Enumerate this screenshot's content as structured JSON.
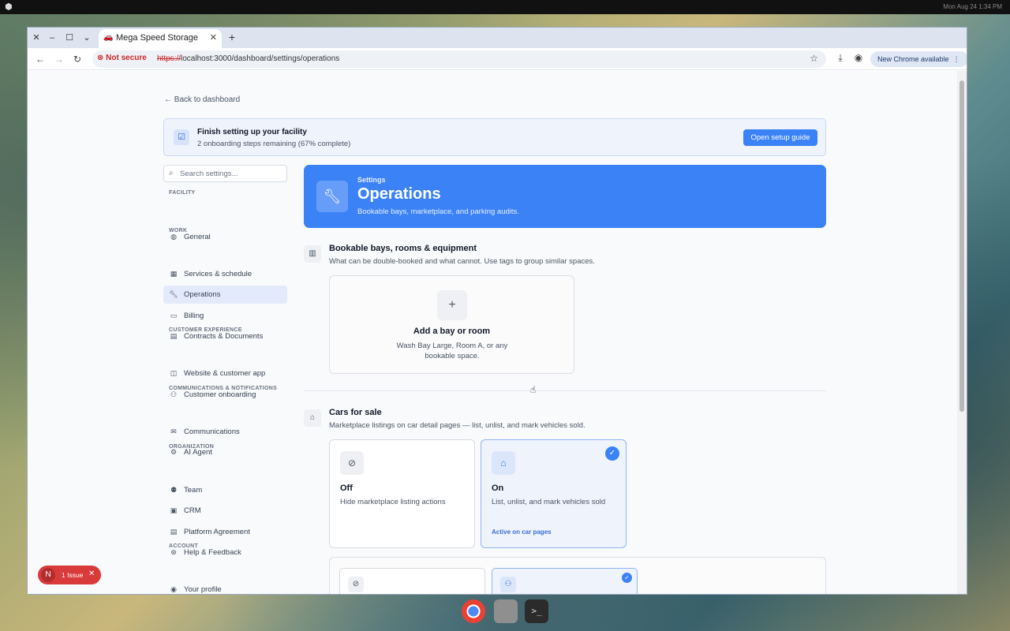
{
  "os": {
    "clock": "Mon Aug 24  1:34 PM"
  },
  "browser": {
    "tab_title": "Mega Speed Storage",
    "not_secure": "Not secure",
    "url_scheme": "https://",
    "url_rest": "localhost:3000/dashboard/settings/operations",
    "new_chrome": "New Chrome available"
  },
  "page": {
    "back_link": "Back to dashboard",
    "banner": {
      "title": "Finish setting up your facility",
      "subtitle": "2 onboarding steps remaining (67% complete)",
      "button": "Open setup guide"
    },
    "search_placeholder": "Search settings...",
    "sidebar": {
      "facility": "FACILITY",
      "general": "General",
      "work": "WORK",
      "services": "Services & schedule",
      "operations": "Operations",
      "billing": "Billing",
      "contracts": "Contracts & Documents",
      "customer_experience": "CUSTOMER EXPERIENCE",
      "website": "Website & customer app",
      "onboarding": "Customer onboarding",
      "comms_section": "COMMUNICATIONS & NOTIFICATIONS",
      "communications": "Communications",
      "ai_agent": "AI Agent",
      "organization": "ORGANIZATION",
      "team": "Team",
      "crm": "CRM",
      "platform": "Platform Agreement",
      "help": "Help & Feedback",
      "account": "ACCOUNT",
      "profile": "Your profile"
    },
    "hero": {
      "eyebrow": "Settings",
      "title": "Operations",
      "subtitle": "Bookable bays, marketplace, and parking audits."
    },
    "bays": {
      "title": "Bookable bays, rooms & equipment",
      "subtitle": "What can be double-booked and what cannot. Use tags to group similar spaces.",
      "add_title": "Add a bay or room",
      "add_subtitle": "Wash Bay Large, Room A, or any bookable space."
    },
    "cars": {
      "title": "Cars for sale",
      "subtitle": "Marketplace listings on car detail pages — list, unlist, and mark vehicles sold.",
      "off_title": "Off",
      "off_sub": "Hide marketplace listing actions",
      "on_title": "On",
      "on_sub": "List, unlist, and mark vehicles sold",
      "on_active": "Active on car pages"
    },
    "issue_badge": {
      "letter": "N",
      "label": "1 Issue"
    }
  }
}
